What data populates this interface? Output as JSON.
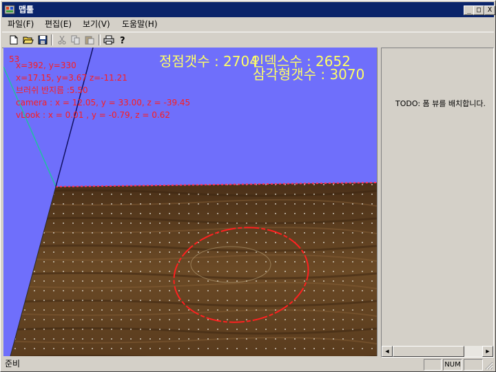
{
  "window": {
    "title": "맵툴"
  },
  "titlebar_buttons": {
    "minimize": "_",
    "maximize": "□",
    "close": "X"
  },
  "menu": [
    {
      "label": "파일(F)"
    },
    {
      "label": "편집(E)"
    },
    {
      "label": "보기(V)"
    },
    {
      "label": "도움말(H)"
    }
  ],
  "toolbar": {
    "icons": [
      "new-file-icon",
      "open-folder-icon",
      "save-icon",
      "cut-icon",
      "copy-icon",
      "paste-icon",
      "print-icon",
      "help-icon"
    ]
  },
  "viewport": {
    "fps": "53",
    "mouse_screen": "x=392, y=330",
    "mouse_world": "x=17.15, y=3.67 z=-11.21",
    "brush_radius": "브러쉬 반지름 :5.50",
    "camera": "camera : x = 12.05, y = 33.00, z = -39.45",
    "look": "vLook : x = 0.01 , y = -0.79, z = 0.62",
    "vertex_count": "정점갯수 : 2704",
    "index_count": "인덱스수 : 2652",
    "triangle_count": "삼각형갯수 : 3070",
    "colors": {
      "sky": "#6f6ffb",
      "overlay_red": "#ff1c1c",
      "overlay_yellow": "#ffff66",
      "brush_circle": "#ff2020",
      "terrain": "#5e4022"
    }
  },
  "right_pane": {
    "message": "TODO: 폼 뷰를 배치합니다."
  },
  "statusbar": {
    "text": "준비",
    "num": "NUM"
  }
}
